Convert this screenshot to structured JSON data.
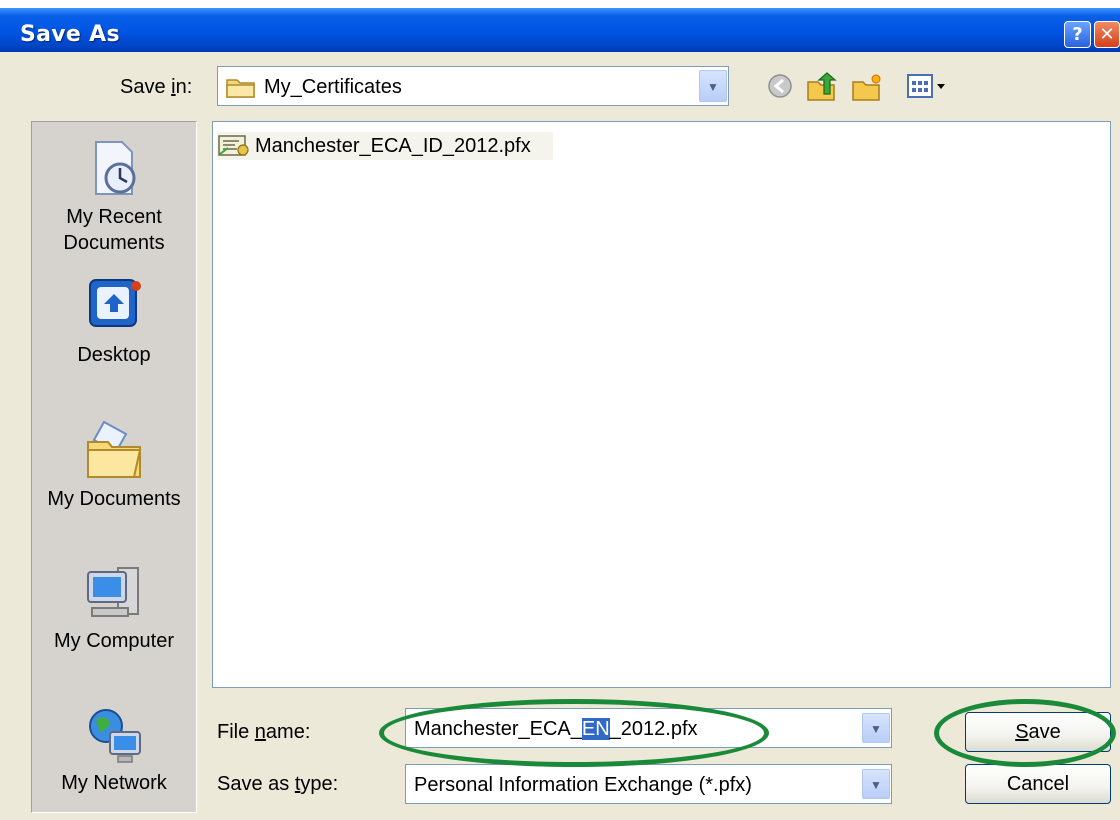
{
  "window": {
    "title": "Save As"
  },
  "savein": {
    "label_pre": "Save ",
    "label_key": "i",
    "label_post": "n:",
    "folder": "My_Certificates"
  },
  "places": [
    {
      "line1": "My Recent",
      "line2": "Documents"
    },
    {
      "line1": "Desktop",
      "line2": ""
    },
    {
      "line1": "My Documents",
      "line2": ""
    },
    {
      "line1": "My Computer",
      "line2": ""
    },
    {
      "line1": "My Network",
      "line2": ""
    }
  ],
  "files": [
    {
      "name": "Manchester_ECA_ID_2012.pfx"
    }
  ],
  "filename": {
    "label_pre": "File ",
    "label_key": "n",
    "label_post": "ame:",
    "value_pre": "Manchester_ECA_",
    "value_sel": "EN",
    "value_post": "_2012.pfx"
  },
  "savetype": {
    "label_pre": "Save as ",
    "label_key": "t",
    "label_post": "ype:",
    "value": "Personal Information Exchange (*.pfx)"
  },
  "buttons": {
    "save_key": "S",
    "save_rest": "ave",
    "cancel": "Cancel"
  },
  "colors": {
    "annotation": "#1a8a3a",
    "titlebar": "#0054e3",
    "selection": "#316ac5"
  }
}
